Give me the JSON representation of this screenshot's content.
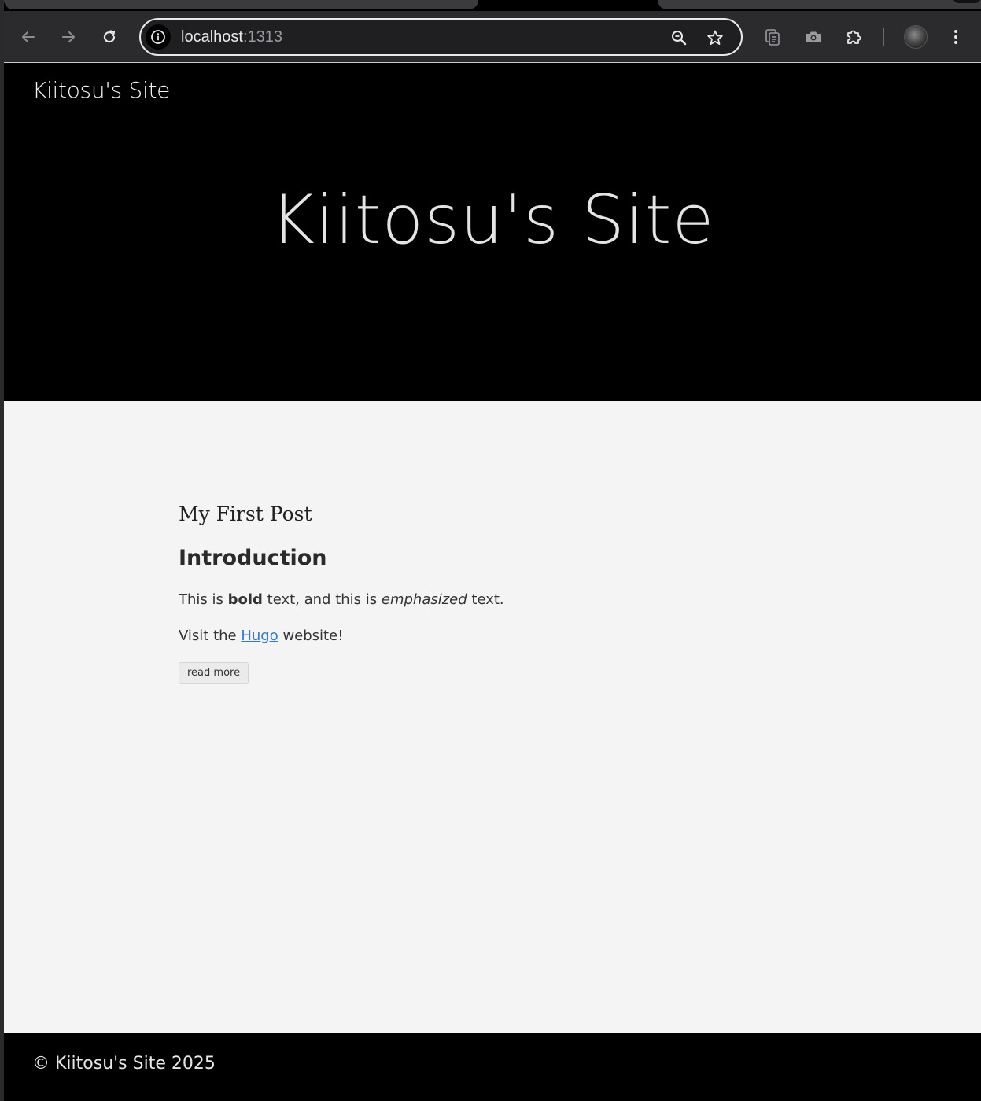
{
  "browser": {
    "url_host": "localhost",
    "url_port": ":1313",
    "icons": {
      "back": "arrow-left-icon",
      "forward": "arrow-right-icon",
      "reload": "reload-icon",
      "site_info": "info-icon",
      "zoom": "magnifier-zoom-icon",
      "bookmark": "star-icon",
      "tab_search": "tab-groups-icon",
      "screenshot": "camera-icon",
      "extensions": "puzzle-icon",
      "menu": "kebab-menu-icon"
    }
  },
  "site": {
    "brand": "Kiitosu's Site",
    "hero_title": "Kiitosu's Site"
  },
  "post": {
    "title": "My First Post",
    "heading": "Introduction",
    "p1_before": "This is ",
    "p1_bold": "bold",
    "p1_middle": " text, and this is ",
    "p1_em": "emphasized",
    "p1_after": " text.",
    "p2_before": "Visit the ",
    "p2_link": "Hugo",
    "p2_after": " website!",
    "read_more": "read more"
  },
  "footer": {
    "text": "© Kiitosu's Site 2025"
  },
  "colors": {
    "hero_bg": "#000000",
    "page_bg": "#f4f4f4",
    "link": "#2f7bd6",
    "toolbar_bg": "#2b2b2d"
  }
}
